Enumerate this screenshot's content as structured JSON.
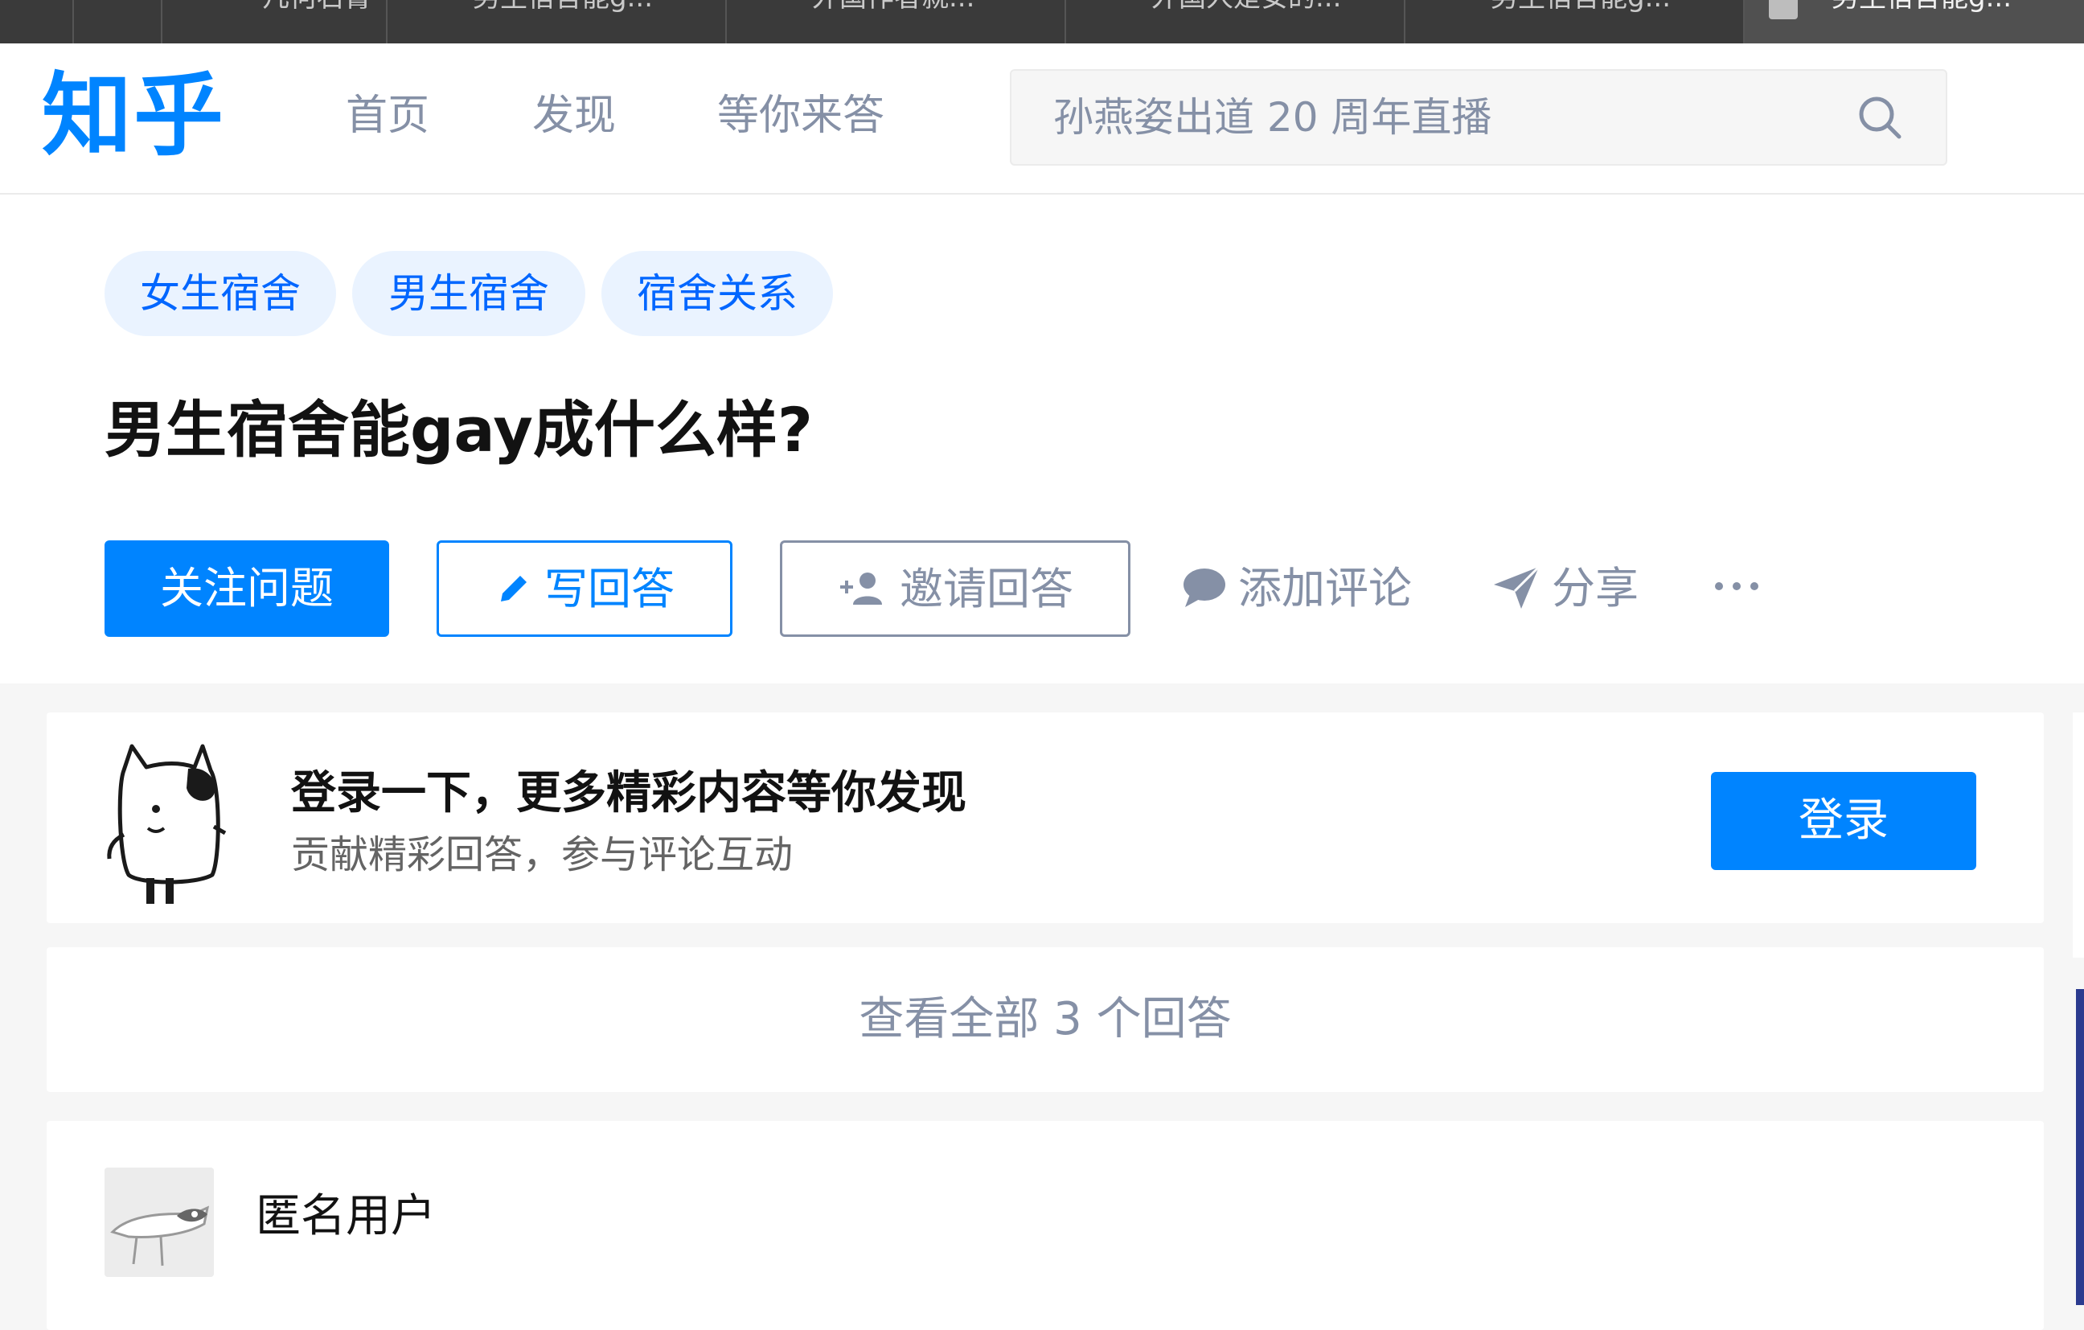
{
  "browser": {
    "tabs": [
      "几何石膏",
      "男生宿舍能g...",
      "外国作者就...",
      "外国人是安的...",
      "男生宿舍能g...",
      "男生宿舍能g..."
    ]
  },
  "header": {
    "logo": "知乎",
    "nav": [
      "首页",
      "发现",
      "等你来答"
    ],
    "search_placeholder": "孙燕姿出道 20 周年直播"
  },
  "question": {
    "tags": [
      "女生宿舍",
      "男生宿舍",
      "宿舍关系"
    ],
    "title": "男生宿舍能gay成什么样?",
    "actions": {
      "follow": "关注问题",
      "write_answer": "写回答",
      "invite": "邀请回答",
      "comment": "添加评论",
      "share": "分享"
    }
  },
  "login_prompt": {
    "title": "登录一下，更多精彩内容等你发现",
    "subtitle": "贡献精彩回答，参与评论互动",
    "button": "登录"
  },
  "view_all": "查看全部 3 个回答",
  "answer": {
    "author": "匿名用户"
  },
  "colors": {
    "brand": "#0084ff",
    "muted_text": "#8590a6",
    "tag_bg": "#eaf3ff"
  }
}
